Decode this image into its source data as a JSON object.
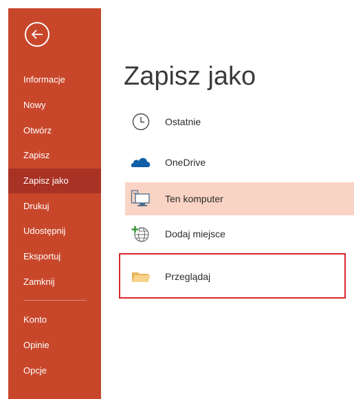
{
  "sidebar": {
    "back_icon": "back-arrow-circle-icon",
    "items": [
      {
        "label": "Informacje"
      },
      {
        "label": "Nowy"
      },
      {
        "label": "Otwórz"
      },
      {
        "label": "Zapisz"
      },
      {
        "label": "Zapisz jako",
        "selected": true
      },
      {
        "label": "Drukuj"
      },
      {
        "label": "Udostępnij"
      },
      {
        "label": "Eksportuj"
      },
      {
        "label": "Zamknij"
      },
      {
        "label": "Konto"
      },
      {
        "label": "Opinie"
      },
      {
        "label": "Opcje"
      }
    ],
    "color": "#c8472b",
    "selected_color": "#a83224"
  },
  "main": {
    "title": "Zapisz jako",
    "locations": [
      {
        "label": "Ostatnie",
        "icon": "clock-icon"
      },
      {
        "label": "OneDrive",
        "icon": "cloud-icon"
      },
      {
        "label": "Ten komputer",
        "icon": "computer-icon",
        "selected": true
      },
      {
        "label": "Dodaj miejsce",
        "icon": "add-place-globe-icon"
      },
      {
        "label": "Przeglądaj",
        "icon": "folder-icon",
        "highlighted": true
      }
    ],
    "selected_bg": "#f9d3c4",
    "highlight_color": "#d9262b"
  }
}
